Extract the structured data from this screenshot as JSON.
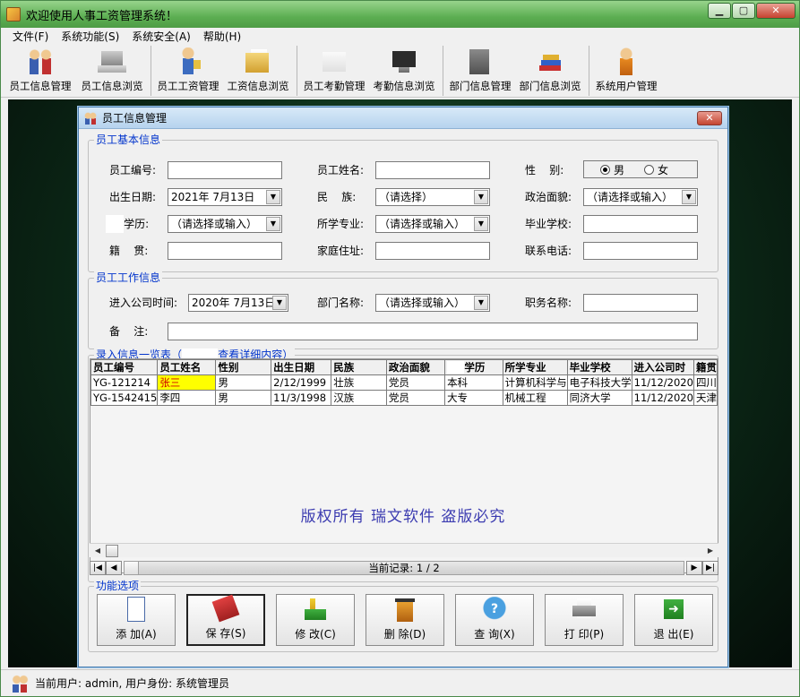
{
  "window": {
    "title": "欢迎使用人事工资管理系统！"
  },
  "menu": [
    {
      "label": "文件(F)"
    },
    {
      "label": "系统功能(S)"
    },
    {
      "label": "系统安全(A)"
    },
    {
      "label": "帮助(H)"
    }
  ],
  "toolbar": [
    {
      "label": "员工信息管理",
      "icon": "people-icon"
    },
    {
      "label": "员工信息浏览",
      "icon": "laptop-icon"
    },
    {
      "label": "员工工资管理",
      "icon": "person-icon"
    },
    {
      "label": "工资信息浏览",
      "icon": "folder-icon"
    },
    {
      "label": "员工考勤管理",
      "icon": "chart-icon"
    },
    {
      "label": "考勤信息浏览",
      "icon": "monitor-icon"
    },
    {
      "label": "部门信息管理",
      "icon": "door-icon"
    },
    {
      "label": "部门信息浏览",
      "icon": "books-icon"
    },
    {
      "label": "系统用户管理",
      "icon": "user-icon"
    }
  ],
  "child": {
    "title": "员工信息管理",
    "close": "✕"
  },
  "basic": {
    "legend": "员工基本信息",
    "emp_id_label": "员工编号:",
    "emp_name_label": "员工姓名:",
    "gender_label": "性    别:",
    "gender_male": "男",
    "gender_female": "女",
    "birth_label": "出生日期:",
    "birth_value": "2021年 7月13日",
    "nation_label": "民    族:",
    "nation_value": "（请选择）",
    "politics_label": "政治面貌:",
    "politics_value": "（请选择或输入）",
    "edu_label": "学历:",
    "edu_value": "（请选择或输入）",
    "major_label": "所学专业:",
    "major_value": "（请选择或输入）",
    "school_label": "毕业学校:",
    "native_label": "籍    贯:",
    "address_label": "家庭住址:",
    "phone_label": "联系电话:"
  },
  "work": {
    "legend": "员工工作信息",
    "join_label": "进入公司时间:",
    "join_value": "2020年 7月13日",
    "dept_label": "部门名称:",
    "dept_value": "（请选择或输入）",
    "job_label": "职务名称:",
    "remark_label": "备    注:"
  },
  "list": {
    "legend_a": "录入信息一览表（",
    "legend_b": "查看详细内容）",
    "columns": [
      "员工编号",
      "员工姓名",
      "性别",
      "出生日期",
      "民族",
      "政治面貌",
      "学历",
      "所学专业",
      "毕业学校",
      "进入公司时",
      "籍贯"
    ],
    "rows": [
      [
        "YG-121214",
        "张三",
        "男",
        "2/12/1999",
        "壮族",
        "党员",
        "本科",
        "计算机科学与",
        "电子科技大学",
        "11/12/2020",
        "四川"
      ],
      [
        "YG-1542415",
        "李四",
        "男",
        "11/3/1998",
        "汉族",
        "党员",
        "大专",
        "机械工程",
        "同济大学",
        "11/12/2020",
        "天津"
      ]
    ],
    "watermark": "版权所有  瑞文软件  盗版必究",
    "record_text": "当前记录:  1 / 2"
  },
  "actions": {
    "legend": "功能选项",
    "buttons": [
      {
        "label": "添 加(A)",
        "icon": "add-icon"
      },
      {
        "label": "保 存(S)",
        "icon": "save-icon"
      },
      {
        "label": "修 改(C)",
        "icon": "edit-icon"
      },
      {
        "label": "删 除(D)",
        "icon": "delete-icon"
      },
      {
        "label": "查 询(X)",
        "icon": "query-icon"
      },
      {
        "label": "打 印(P)",
        "icon": "print-icon"
      },
      {
        "label": "退 出(E)",
        "icon": "exit-icon"
      }
    ]
  },
  "status": {
    "text": "当前用户: admin, 用户身份: 系统管理员"
  }
}
